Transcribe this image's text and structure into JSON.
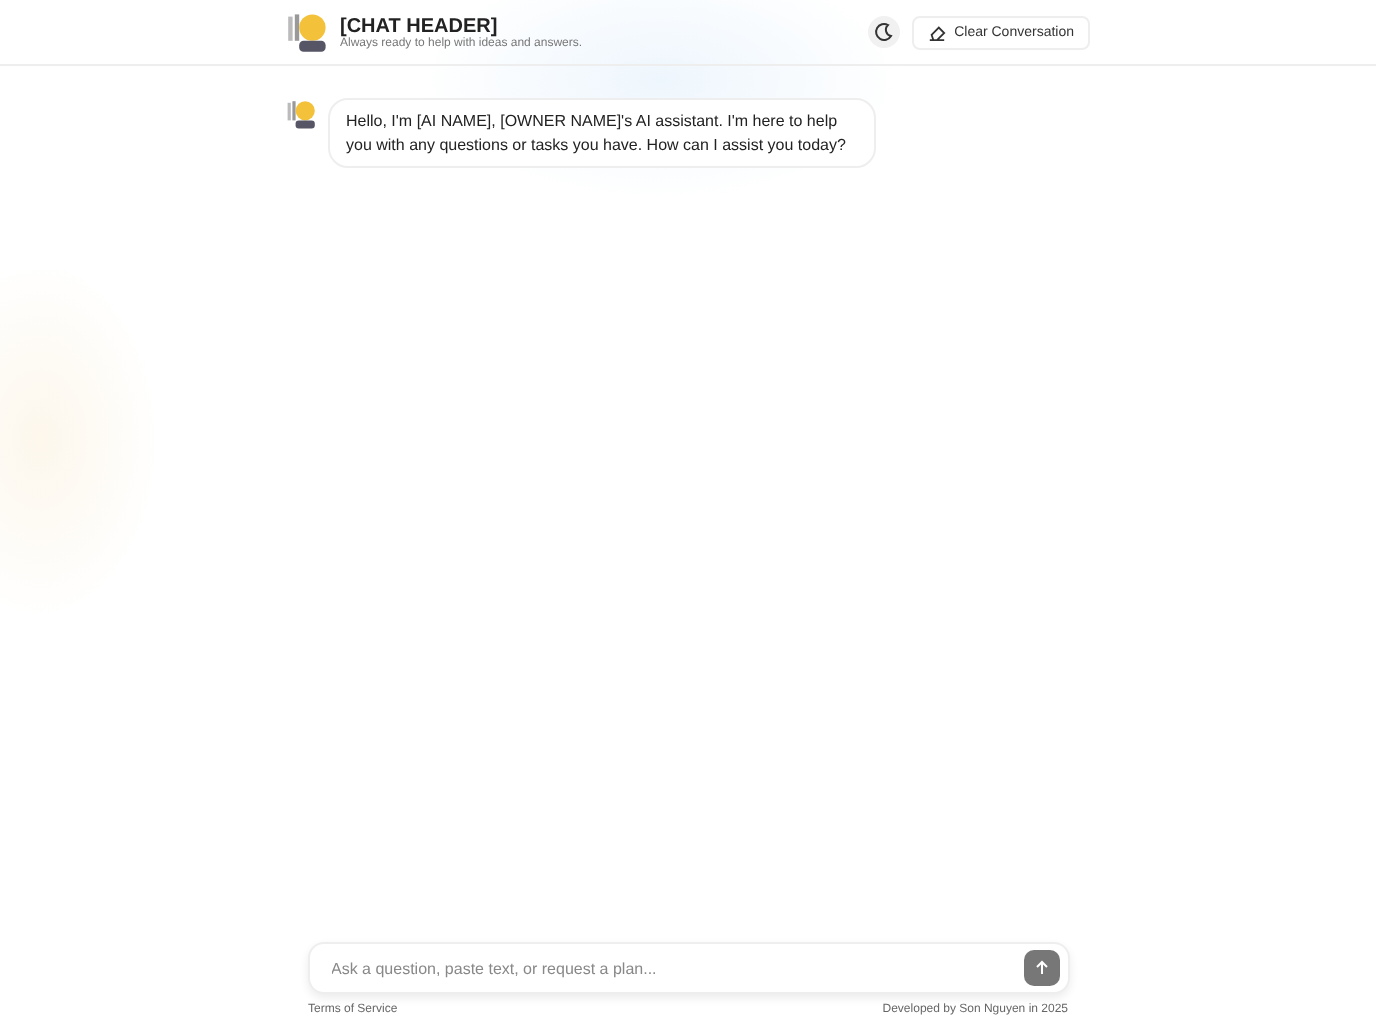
{
  "header": {
    "title": "[CHAT HEADER]",
    "subtitle": "Always ready to help with ideas and answers.",
    "clear_button": "Clear Conversation"
  },
  "messages": [
    {
      "kind": "assistant",
      "text": "Hello, I'm [AI NAME], [OWNER NAME]'s AI assistant. I'm here to help you with any questions or tasks you have. How can I assist you today?"
    }
  ],
  "composer": {
    "placeholder": "Ask a question, paste text, or request a plan..."
  },
  "footer": {
    "left": "Terms of Service",
    "right": "Developed by Son Nguyen in 2025"
  }
}
